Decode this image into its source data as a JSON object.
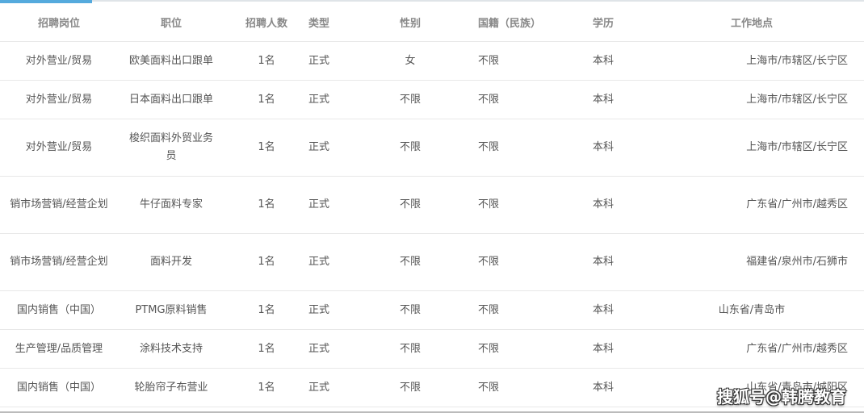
{
  "table": {
    "headers": [
      "招聘岗位",
      "职位",
      "招聘人数",
      "类型",
      "性别",
      "国籍（民族）",
      "学历",
      "工作地点"
    ],
    "rows": [
      [
        "对外营业/贸易",
        "欧美面料出口跟单",
        "1名",
        "正式",
        "女",
        "不限",
        "本科",
        "上海市/市辖区/长宁区"
      ],
      [
        "对外营业/贸易",
        "日本面料出口跟单",
        "1名",
        "正式",
        "不限",
        "不限",
        "本科",
        "上海市/市辖区/长宁区"
      ],
      [
        "对外营业/贸易",
        "梭织面料外贸业务员",
        "1名",
        "正式",
        "不限",
        "不限",
        "本科",
        "上海市/市辖区/长宁区"
      ],
      [
        "销市场营销/经营企划",
        "牛仔面料专家",
        "1名",
        "正式",
        "不限",
        "不限",
        "本科",
        "广东省/广州市/越秀区"
      ],
      [
        "销市场营销/经营企划",
        "面料开发",
        "1名",
        "正式",
        "不限",
        "不限",
        "本科",
        "福建省/泉州市/石狮市"
      ],
      [
        "国内销售（中国）",
        "PTMG原料销售",
        "1名",
        "正式",
        "不限",
        "不限",
        "本科",
        "山东省/青岛市"
      ],
      [
        "生产管理/品质管理",
        "涂料技术支持",
        "1名",
        "正式",
        "不限",
        "不限",
        "本科",
        "广东省/广州市/越秀区"
      ],
      [
        "国内销售（中国）",
        "轮胎帘子布营业",
        "1名",
        "正式",
        "不限",
        "不限",
        "本科",
        "山东省/青岛市/城阳区"
      ]
    ]
  },
  "watermark": "搜狐号@韩腾教育",
  "colors": {
    "accent": "#55aadd",
    "header_text": "#888888",
    "body_text": "#555555",
    "border": "#e8e8e8"
  }
}
